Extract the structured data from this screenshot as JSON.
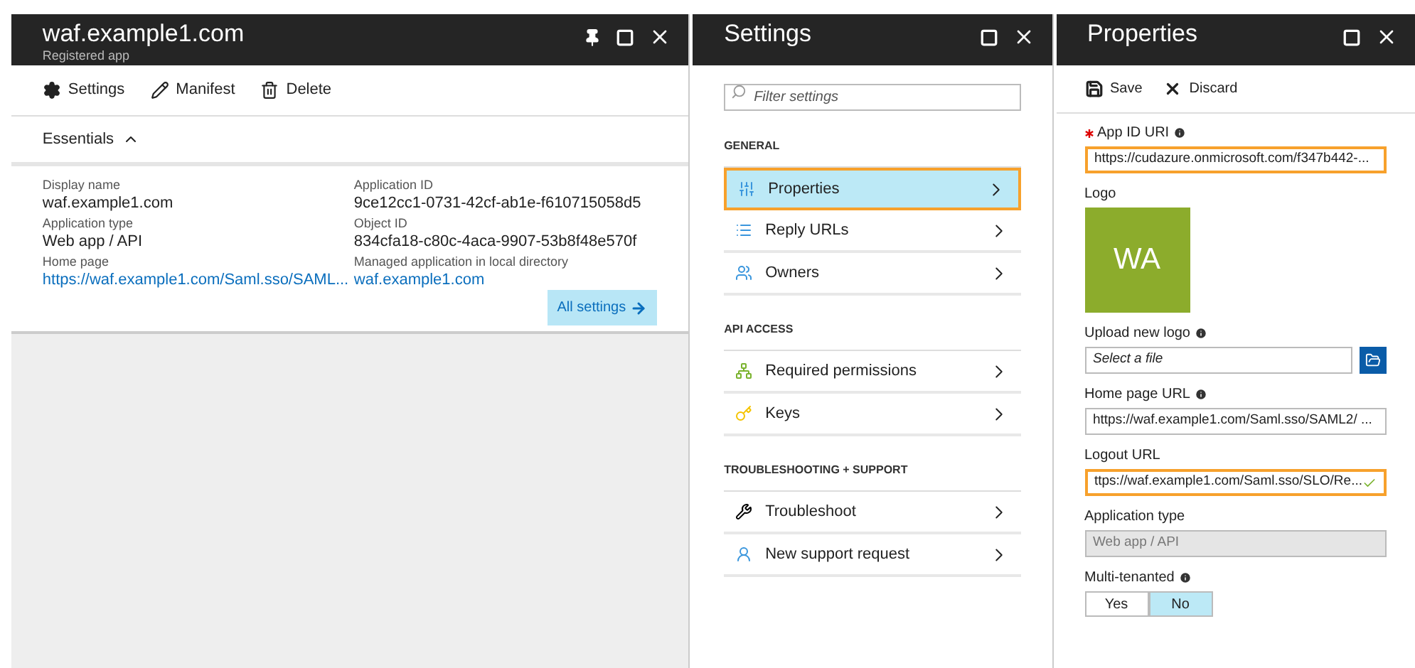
{
  "app_blade": {
    "title": "waf.example1.com",
    "subtitle": "Registered app",
    "toolbar": [
      "Settings",
      "Manifest",
      "Delete"
    ],
    "essentials": {
      "label": "Essentials",
      "expanded": true
    },
    "fields": [
      {
        "label": "Display name",
        "value": "waf.example1.com",
        "link": false
      },
      {
        "label": "Application ID",
        "value": "9ce12cc1-0731-42cf-ab1e-f610715058d5",
        "link": false
      },
      {
        "label": "Application type",
        "value": "Web app / API",
        "link": false
      },
      {
        "label": "Object ID",
        "value": "834cfa18-c80c-4aca-9907-53b8f48e570f",
        "link": false
      },
      {
        "label": "Home page",
        "value": "https://waf.example1.com/Saml.sso/SAML...",
        "link": true
      },
      {
        "label": "Managed application in local directory",
        "value": "waf.example1.com",
        "link": true
      }
    ],
    "all_settings": "All settings"
  },
  "settings_blade": {
    "title": "Settings",
    "search": {
      "placeholder": "Filter settings"
    },
    "groups": [
      {
        "heading": "GENERAL",
        "items": [
          {
            "label": "Properties",
            "selected": true
          },
          {
            "label": "Reply URLs",
            "selected": false
          },
          {
            "label": "Owners",
            "selected": false
          }
        ]
      },
      {
        "heading": "API ACCESS",
        "items": [
          {
            "label": "Required permissions",
            "selected": false
          },
          {
            "label": "Keys",
            "selected": false
          }
        ]
      },
      {
        "heading": "TROUBLESHOOTING + SUPPORT",
        "items": [
          {
            "label": "Troubleshoot",
            "selected": false
          },
          {
            "label": "New support request",
            "selected": false
          }
        ]
      }
    ]
  },
  "properties_blade": {
    "title": "Properties",
    "toolbar": [
      "Save",
      "Discard"
    ],
    "fields": [
      {
        "kind": "text",
        "label": "App ID URI",
        "required": true,
        "info": true,
        "value": "https://cudazure.onmicrosoft.com/f347b442-...",
        "focused": true,
        "valid": false
      },
      {
        "kind": "logo",
        "label": "Logo",
        "initials": "WA",
        "color": "#8cac2c"
      },
      {
        "kind": "file",
        "label": "Upload new logo",
        "info": true,
        "placeholder": "Select a file"
      },
      {
        "kind": "text",
        "label": "Home page URL",
        "info": true,
        "value": "https://waf.example1.com/Saml.sso/SAML2/ ...",
        "focused": false,
        "valid": false
      },
      {
        "kind": "text",
        "label": "Logout URL",
        "value": "ttps://waf.example1.com/Saml.sso/SLO/Re...",
        "focused": true,
        "valid": true
      },
      {
        "kind": "disabled",
        "label": "Application type",
        "value": "Web app / API"
      },
      {
        "kind": "toggle",
        "label": "Multi-tenanted",
        "info": true,
        "options": [
          {
            "label": "Yes",
            "selected": false
          },
          {
            "label": "No",
            "selected": true
          }
        ]
      }
    ]
  }
}
